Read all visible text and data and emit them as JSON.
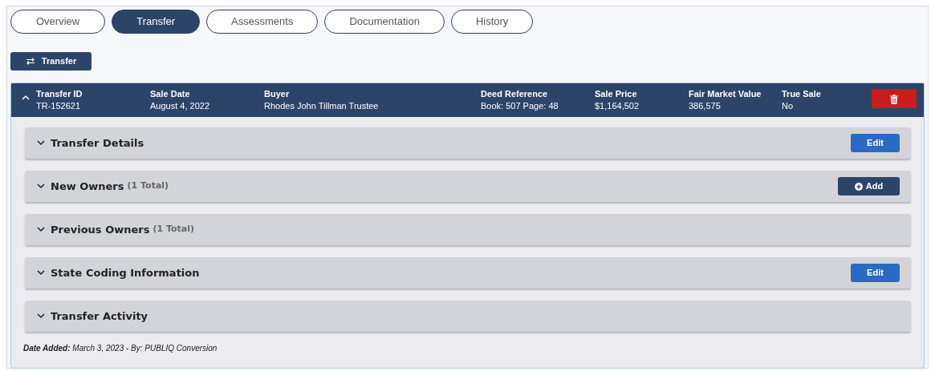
{
  "tabs": [
    {
      "label": "Overview",
      "selected": false
    },
    {
      "label": "Transfer",
      "selected": true
    },
    {
      "label": "Assessments",
      "selected": false
    },
    {
      "label": "Documentation",
      "selected": false
    },
    {
      "label": "History",
      "selected": false
    }
  ],
  "transfer_button": {
    "label": "Transfer"
  },
  "transfer": {
    "expanded": true,
    "fields": [
      {
        "label": "Transfer ID",
        "value": "TR-152621"
      },
      {
        "label": "Sale Date",
        "value": "August 4, 2022"
      },
      {
        "label": "Buyer",
        "value": "Rhodes John Tillman Trustee"
      },
      {
        "label": "Deed Reference",
        "value": "Book: 507 Page: 48"
      },
      {
        "label": "Sale Price",
        "value": "$1,164,502"
      },
      {
        "label": "Fair Market Value",
        "value": "386,575"
      },
      {
        "label": "True Sale",
        "value": "No"
      }
    ],
    "sections": [
      {
        "title": "Transfer Details",
        "expanded": false,
        "action": {
          "kind": "edit",
          "label": "Edit"
        }
      },
      {
        "title": "New Owners",
        "count": "(1 Total)",
        "expanded": false,
        "action": {
          "kind": "add",
          "label": "Add"
        }
      },
      {
        "title": "Previous Owners",
        "count": "(1 Total)",
        "expanded": false
      },
      {
        "title": "State Coding Information",
        "expanded": false,
        "action": {
          "kind": "edit",
          "label": "Edit"
        }
      },
      {
        "title": "Transfer Activity",
        "expanded": false
      }
    ],
    "footer": "**Date Added:** March 3, 2023 - By: PUBLIQ Conversion"
  }
}
